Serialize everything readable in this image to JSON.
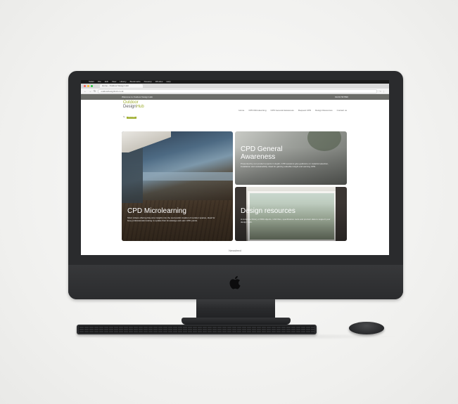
{
  "colors": {
    "brand_green": "#9fae2f",
    "topbar": "#6b6c68",
    "imac_body": "#2a2b2d"
  },
  "mac_menubar": {
    "items": [
      "Safari",
      "File",
      "Edit",
      "View",
      "History",
      "Bookmarks",
      "Develop",
      "Window",
      "Help"
    ]
  },
  "browser": {
    "tab_title": "Home - Outdoor Design Hub",
    "url": "outdoordesignhub.co.uk"
  },
  "site": {
    "topbar_left": "Welcome to Outdoor Design Hub",
    "topbar_right": "01234 567890",
    "logo": {
      "line1": "Outdoor",
      "line2a": "Design",
      "line2b": "Hub",
      "tag_pre": "by",
      "tag": "Marshalls"
    },
    "nav": [
      "Home",
      "CPD Microlearning",
      "CPD General Awareness",
      "Request CPD",
      "Design Resources",
      "Contact us"
    ],
    "tiles": {
      "big": {
        "title": "CPD Microlearning",
        "desc": "Short videos offering bite-size insights into the successful creation of outdoor spaces, ideal for busy professionals looking to update their knowledge and earn CPD points."
      },
      "top_right": {
        "title": "CPD General Awareness",
        "desc": "Presented by our product experts in depth, CPD sessions give guidance on material selection, installation and sustainability. Ideal for gaining valuable insight and earning CPD."
      },
      "bottom_right": {
        "title": "Design resources",
        "desc": "A complete library of BIM objects, CAD files, specification tools and product data to support your design work."
      }
    },
    "footer_label": "Newsfeed"
  }
}
